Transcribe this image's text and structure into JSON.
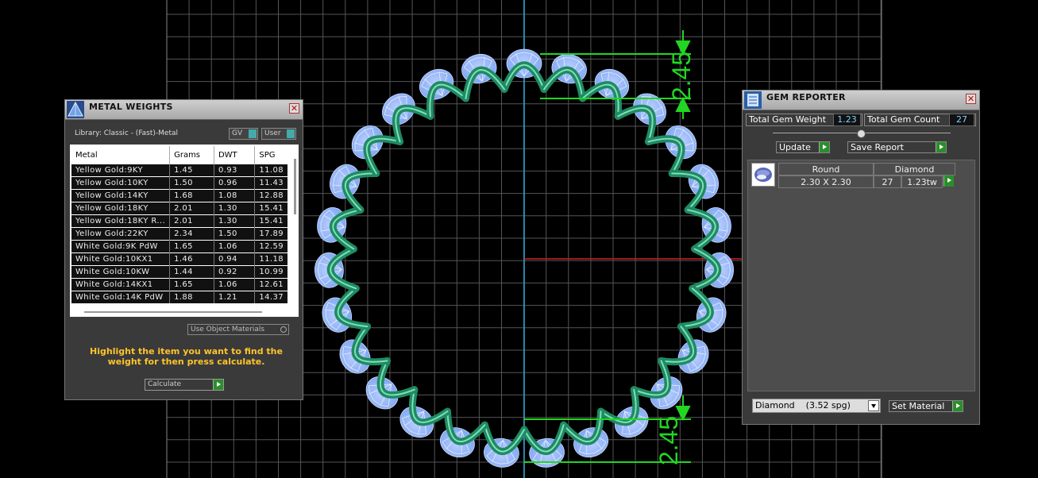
{
  "metal_panel": {
    "title": "METAL WEIGHTS",
    "library_label": "Library: Classic - (Fast)-Metal",
    "toggle_gv": "GV",
    "toggle_user": "User",
    "columns": [
      "Metal",
      "Grams",
      "DWT",
      "SPG"
    ],
    "rows": [
      [
        "Yellow Gold:9KY",
        "1.45",
        "0.93",
        "11.08"
      ],
      [
        "Yellow Gold:10KY",
        "1.50",
        "0.96",
        "11.43"
      ],
      [
        "Yellow Gold:14KY",
        "1.68",
        "1.08",
        "12.88"
      ],
      [
        "Yellow Gold:18KY",
        "2.01",
        "1.30",
        "15.41"
      ],
      [
        "Yellow Gold:18KY R...",
        "2.01",
        "1.30",
        "15.41"
      ],
      [
        "Yellow Gold:22KY",
        "2.34",
        "1.50",
        "17.89"
      ],
      [
        "White Gold:9K PdW",
        "1.65",
        "1.06",
        "12.59"
      ],
      [
        "White Gold:10KX1",
        "1.46",
        "0.94",
        "11.18"
      ],
      [
        "White Gold:10KW",
        "1.44",
        "0.92",
        "10.99"
      ],
      [
        "White Gold:14KX1",
        "1.65",
        "1.06",
        "12.61"
      ],
      [
        "White Gold:14K PdW",
        "1.88",
        "1.21",
        "14.37"
      ]
    ],
    "use_object_materials": "Use Object Materials",
    "hint": "Highlight the item you want to find the weight for then press calculate.",
    "calculate_label": "Calculate"
  },
  "gem_panel": {
    "title": "GEM REPORTER",
    "total_weight_label": "Total Gem Weight",
    "total_weight_value": "1.23",
    "total_count_label": "Total Gem Count",
    "total_count_value": "27",
    "update_label": "Update",
    "save_report_label": "Save Report",
    "gem_row": {
      "shape": "Round",
      "size": "2.30 X 2.30",
      "material": "Diamond",
      "count": "27",
      "weight": "1.23tw"
    },
    "material_select": "Diamond    (3.52 spg)",
    "set_material_label": "Set Material"
  },
  "viewport": {
    "dimension_top": "2.45",
    "dimension_bottom": "2.45",
    "colors": {
      "grid": "#555555",
      "metal": "#1f8a63",
      "gem": "#7da6f0",
      "dimension": "#22d622",
      "axis_x": "#d32020",
      "axis_y": "#2fa6d9"
    }
  }
}
